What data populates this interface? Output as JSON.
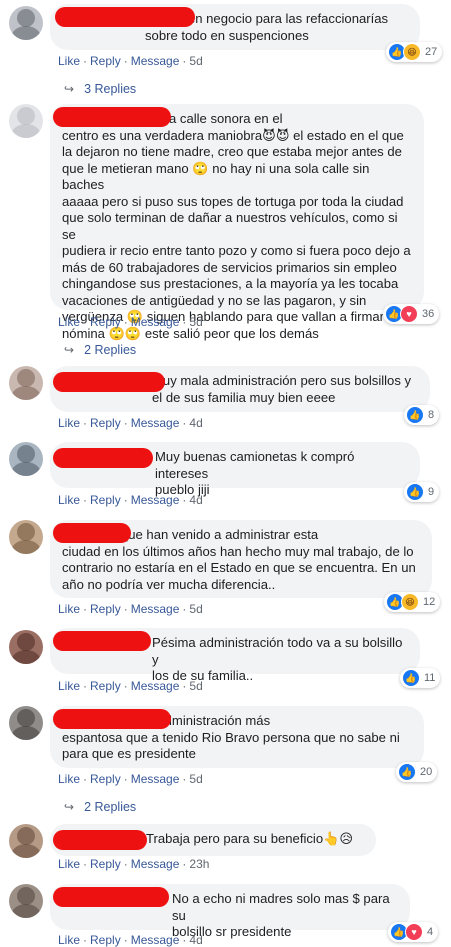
{
  "actions": {
    "like": "Like",
    "reply": "Reply",
    "message": "Message",
    "sep": "·"
  },
  "comments": [
    {
      "text": "Muy buen negocio para las refaccionarías\nsobre todo en suspenciones",
      "reactions": [
        "like",
        "haha"
      ],
      "count": "27",
      "time": "5d"
    },
    {
      "text": "Nomas pasar por la calle sonora en el\ncentro es una verdadera maniobra😈😈 el estado en el que\nla dejaron no tiene madre, creo que estaba mejor antes de\nque le metieran mano 🙄 no hay ni una sola calle sin baches\naaaaa pero si puso sus topes de tortuga por toda la ciudad\nque solo terminan de dañar a nuestros vehículos, como si se\npudiera ir recio entre tanto pozo y como si fuera poco dejo a\nmás de 60 trabajadores de servicios primarios sin empleo\nchingandose sus prestaciones, a la mayoría ya les tocaba\nvacaciones de antigüedad y no se las pagaron, y sin\nvergüenza 🙄 siguen hablando para que vallan a firmar\nnómina 🙄🙄 este salió peor que los demás",
      "reactions": [
        "like",
        "love"
      ],
      "count": "36",
      "time": "5d"
    },
    {
      "text": "Muy mala administración pero sus bolsillos y\nel de sus familia muy bien eeee",
      "reactions": [
        "like"
      ],
      "count": "8",
      "time": "4d"
    },
    {
      "text": "Muy buenas camionetas k compró intereses\npueblo jiji",
      "reactions": [
        "like"
      ],
      "count": "9",
      "time": "4d"
    },
    {
      "text": "Todos los que han venido a administrar esta\nciudad en los últimos años han hecho muy mal trabajo, de lo\ncontrario no estaría en el Estado en que se encuentra. En un\naño no podría ver mucha diferencia..",
      "reactions": [
        "like",
        "haha"
      ],
      "count": "12",
      "time": "5d"
    },
    {
      "text": "Pésima administración todo va a su bolsillo y\nlos de su familia..",
      "reactions": [
        "like"
      ],
      "count": "11",
      "time": "5d"
    },
    {
      "text": "De lo peor es la administración más\nespantosa que a tenido Rio Bravo persona que no sabe ni\npara que es presidente",
      "reactions": [
        "like"
      ],
      "count": "20",
      "time": "5d"
    },
    {
      "text": "Trabaja pero para su beneficio👆😥",
      "reactions": [],
      "count": "",
      "time": "23h"
    },
    {
      "text": "No a echo ni madres solo mas $ para su\nbolsillo sr presidente",
      "reactions": [
        "like",
        "love"
      ],
      "count": "4",
      "time": "4d"
    }
  ],
  "reply_links": [
    "3 Replies",
    "2 Replies",
    "2 Replies"
  ],
  "colors": {
    "link": "#385898",
    "bubble": "#f2f3f5",
    "redaction": "#ee1111",
    "like": "#1877f2"
  }
}
